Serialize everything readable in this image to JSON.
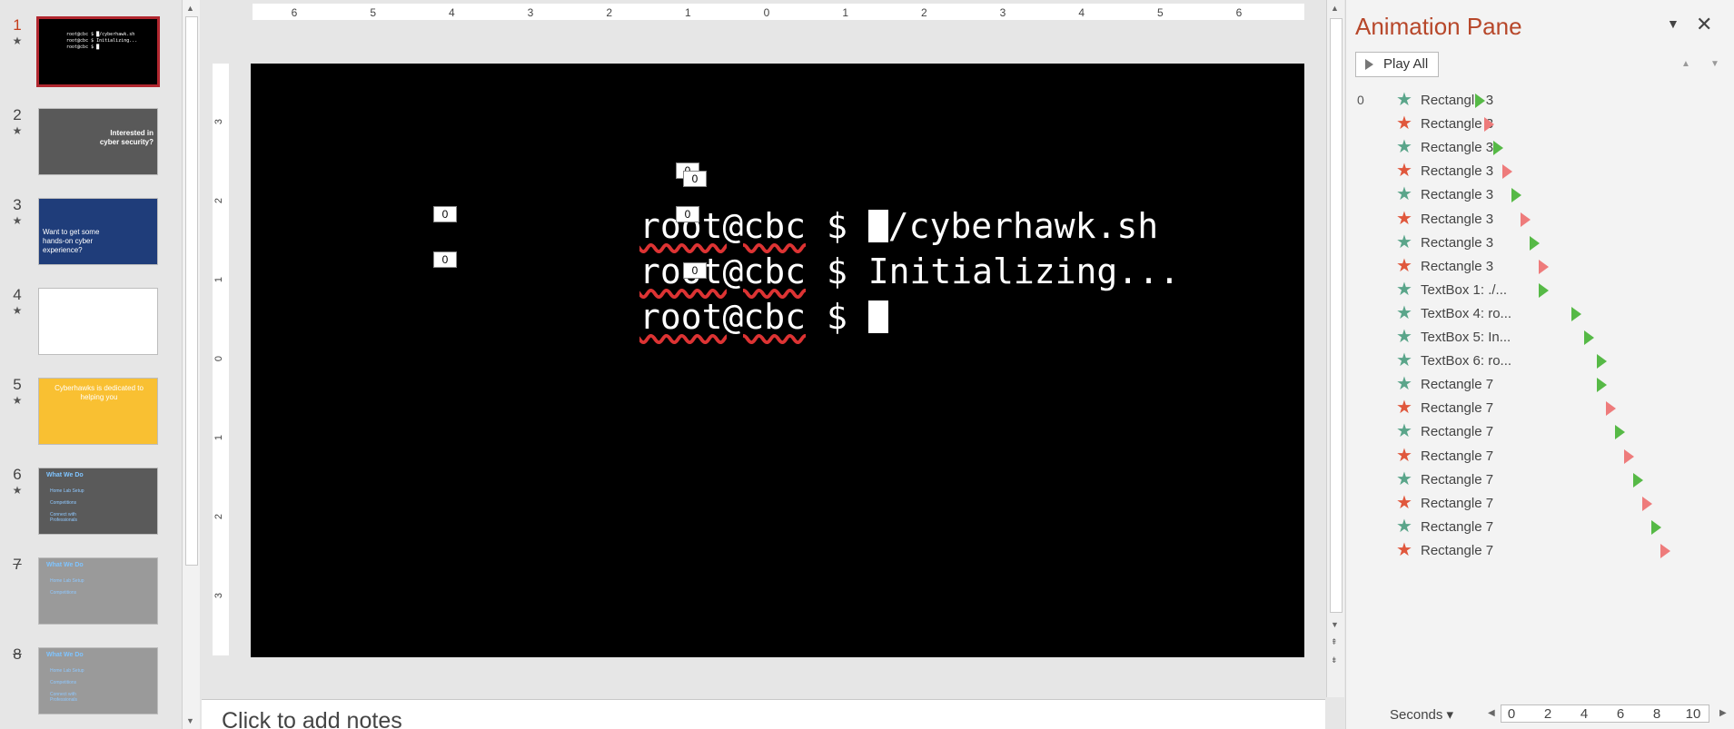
{
  "thumbnails": [
    {
      "num": "1",
      "active": true,
      "hidden": false,
      "style": "terminal",
      "mini_lines": [
        "root@cbc $ █/cyberhawk.sh",
        "root@cbc $ Initializing...",
        "root@cbc $ █"
      ]
    },
    {
      "num": "2",
      "active": false,
      "hidden": false,
      "style": "dark-circuit",
      "text": "Interested in cyber security?"
    },
    {
      "num": "3",
      "active": false,
      "hidden": false,
      "style": "blue",
      "text": "Want to get some hands-on cyber experience?"
    },
    {
      "num": "4",
      "active": false,
      "hidden": false,
      "style": "blank"
    },
    {
      "num": "5",
      "active": false,
      "hidden": false,
      "style": "yellow",
      "text": "Cyberhawks is dedicated to helping you"
    },
    {
      "num": "6",
      "active": false,
      "hidden": false,
      "style": "gray-what",
      "title": "What We Do",
      "lines": [
        "Home Lab Setup",
        "Competitions",
        "Connect with Professionals"
      ]
    },
    {
      "num": "7",
      "active": false,
      "hidden": true,
      "style": "gray-light",
      "title": "What We Do",
      "lines": [
        "Home Lab Setup",
        "Competitions"
      ]
    },
    {
      "num": "8",
      "active": false,
      "hidden": true,
      "style": "gray-light",
      "title": "What We Do",
      "lines": [
        "Home Lab Setup",
        "Competitions",
        "Connect with Professionals"
      ]
    }
  ],
  "ruler": {
    "horizontal": [
      "6",
      "5",
      "4",
      "3",
      "2",
      "1",
      "0",
      "1",
      "2",
      "3",
      "4",
      "5",
      "6"
    ],
    "vertical": [
      "3",
      "2",
      "1",
      "0",
      "1",
      "2",
      "3"
    ]
  },
  "slide": {
    "lines": [
      {
        "prompt": "root@cbc",
        "rest_before_cursor": " $ ",
        "cursor": true,
        "rest_after_cursor": "/cyberhawk.sh"
      },
      {
        "prompt": "root@cbc",
        "rest_before_cursor": " $ Initializing...",
        "cursor": false,
        "rest_after_cursor": ""
      },
      {
        "prompt": "root@cbc",
        "rest_before_cursor": " $ ",
        "cursor": true,
        "rest_after_cursor": ""
      }
    ],
    "anim_tags": [
      "0",
      "0",
      "0",
      "0",
      "0",
      "0"
    ]
  },
  "notes": {
    "placeholder": "Click to add notes"
  },
  "anim_pane": {
    "title": "Animation Pane",
    "play_all": "Play All",
    "items": [
      {
        "num": "0",
        "name": "Rectangle 3",
        "effect": "entrance"
      },
      {
        "num": "",
        "name": "Rectangle 3",
        "effect": "exit"
      },
      {
        "num": "",
        "name": "Rectangle 3",
        "effect": "entrance"
      },
      {
        "num": "",
        "name": "Rectangle 3",
        "effect": "exit"
      },
      {
        "num": "",
        "name": "Rectangle 3",
        "effect": "entrance"
      },
      {
        "num": "",
        "name": "Rectangle 3",
        "effect": "exit"
      },
      {
        "num": "",
        "name": "Rectangle 3",
        "effect": "entrance"
      },
      {
        "num": "",
        "name": "Rectangle 3",
        "effect": "exit"
      },
      {
        "num": "",
        "name": "TextBox 1: ./...",
        "effect": "entrance"
      },
      {
        "num": "",
        "name": "TextBox 4: ro...",
        "effect": "entrance"
      },
      {
        "num": "",
        "name": "TextBox 5: In...",
        "effect": "entrance"
      },
      {
        "num": "",
        "name": "TextBox 6: ro...",
        "effect": "entrance"
      },
      {
        "num": "",
        "name": "Rectangle 7",
        "effect": "entrance"
      },
      {
        "num": "",
        "name": "Rectangle 7",
        "effect": "exit"
      },
      {
        "num": "",
        "name": "Rectangle 7",
        "effect": "entrance"
      },
      {
        "num": "",
        "name": "Rectangle 7",
        "effect": "exit"
      },
      {
        "num": "",
        "name": "Rectangle 7",
        "effect": "entrance"
      },
      {
        "num": "",
        "name": "Rectangle 7",
        "effect": "exit"
      },
      {
        "num": "",
        "name": "Rectangle 7",
        "effect": "entrance"
      },
      {
        "num": "",
        "name": "Rectangle 7",
        "effect": "exit"
      }
    ],
    "timeline": {
      "unit_label": "Seconds",
      "ticks": [
        "0",
        "2",
        "4",
        "6",
        "8",
        "10"
      ]
    }
  },
  "colors": {
    "entrance": "#56b946",
    "exit": "#e0573c",
    "accent": "#b7472a"
  }
}
